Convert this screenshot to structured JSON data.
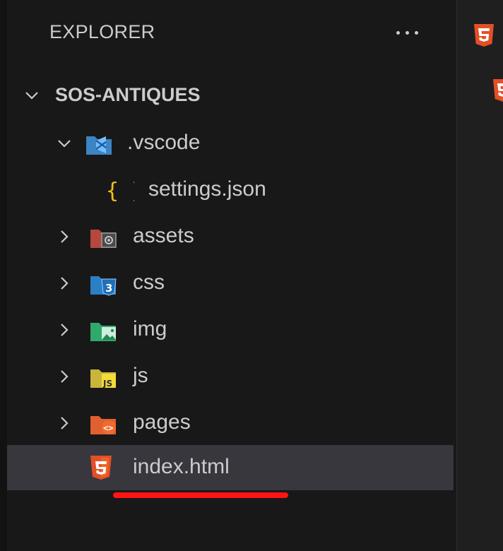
{
  "explorer": {
    "title": "EXPLORER",
    "more_actions_icon": "ellipsis-icon",
    "root": {
      "label": "SOS-ANTIQUES",
      "expanded": true
    },
    "items": [
      {
        "label": ".vscode",
        "kind": "folder",
        "icon": "vscode-folder-icon",
        "expanded": true,
        "color": "#3c84c4"
      },
      {
        "label": "settings.json",
        "kind": "file",
        "icon": "json-braces-icon",
        "color": "#e8c21c"
      },
      {
        "label": "assets",
        "kind": "folder",
        "icon": "assets-folder-icon",
        "expanded": false,
        "color": "#b6473f"
      },
      {
        "label": "css",
        "kind": "folder",
        "icon": "css-folder-icon",
        "expanded": false,
        "color": "#2b7fc7"
      },
      {
        "label": "img",
        "kind": "folder",
        "icon": "image-folder-icon",
        "expanded": false,
        "color": "#2faa6a"
      },
      {
        "label": "js",
        "kind": "folder",
        "icon": "js-folder-icon",
        "expanded": false,
        "color": "#c8b53a"
      },
      {
        "label": "pages",
        "kind": "folder",
        "icon": "html-folder-icon",
        "expanded": false,
        "color": "#e0602f"
      },
      {
        "label": "index.html",
        "kind": "file",
        "icon": "html5-icon",
        "selected": true,
        "color": "#e34f26"
      }
    ]
  },
  "colors": {
    "panel_bg": "#181818",
    "selected_bg": "#37373d",
    "text": "#cccccc",
    "annotation_red": "#ff1414",
    "html_orange": "#e34f26"
  }
}
